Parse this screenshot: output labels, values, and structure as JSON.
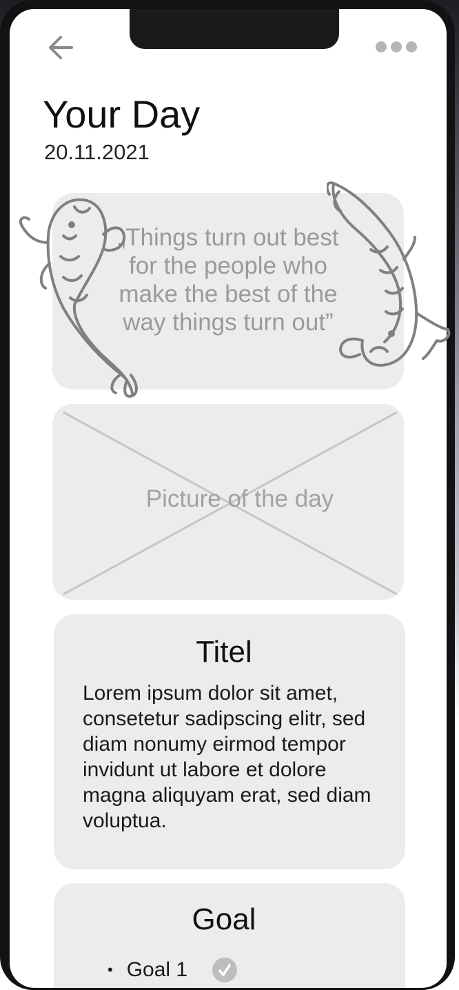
{
  "header": {
    "title": "Your Day",
    "date": "20.11.2021"
  },
  "quote": {
    "text": "„Things turn out best for the people who make the best of the way things turn out”"
  },
  "picture": {
    "label": "Picture of the day"
  },
  "article": {
    "title": "Titel",
    "body": "Lorem ipsum dolor sit amet, consetetur sadipscing elitr, sed diam nonumy eirmod tempor invidunt ut labore et dolore magna aliquyam erat, sed diam voluptua."
  },
  "goals": {
    "title": "Goal",
    "items": [
      {
        "label": "Goal 1",
        "done": true
      }
    ]
  },
  "icons": {
    "back": "arrow-left-icon",
    "more": "more-horizontal-icon",
    "check": "check-icon",
    "decoration": "koi-fish-icon"
  },
  "colors": {
    "card": "#ececec",
    "muted_text": "#9a9a9a",
    "icon": "#8a8a8a"
  }
}
